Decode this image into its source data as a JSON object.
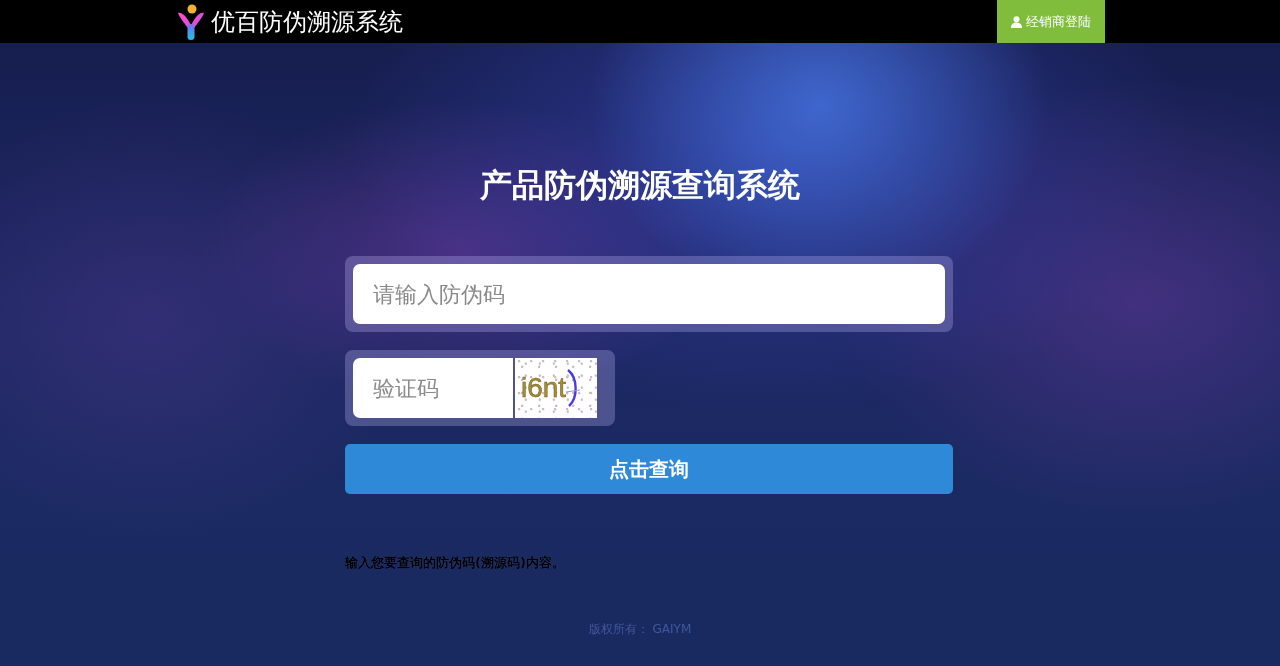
{
  "header": {
    "logo_text": "优百防伪溯源系统",
    "login_button": "经销商登陆"
  },
  "title": "产品防伪溯源查询系统",
  "form": {
    "code_field": {
      "placeholder": "请输入防伪码"
    },
    "captcha_field": {
      "placeholder": "验证码"
    },
    "captcha_image": {
      "code": "i6nt"
    },
    "submit_button": "点击查询"
  },
  "hint": "输入您要查询的防伪码(溯源码)内容。",
  "footer": "版权所有： GAIYM"
}
